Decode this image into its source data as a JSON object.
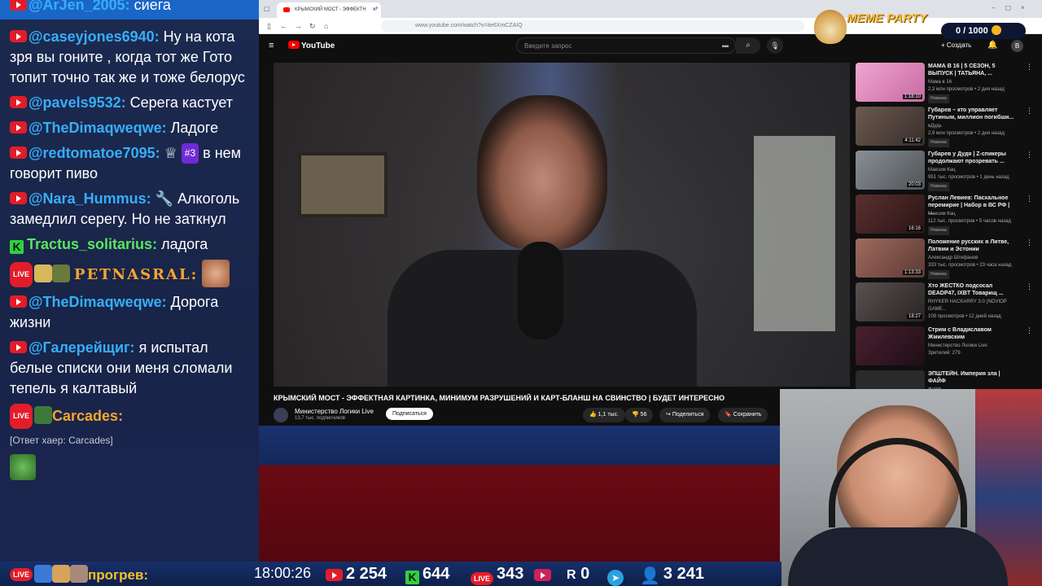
{
  "chat": {
    "messages": [
      {
        "platform": "youtube",
        "user": "@ArJen_2005:",
        "text": "сиега"
      },
      {
        "platform": "youtube",
        "user": "@caseyjones6940:",
        "text": "Ну на кота зря вы гоните , когда тот же Гото топит точно так же и тоже белорус"
      },
      {
        "platform": "youtube",
        "user": "@pavels9532:",
        "text": "Серега кастует"
      },
      {
        "platform": "youtube",
        "user": "@TheDimaqweqwe:",
        "text": "Ладоге"
      },
      {
        "platform": "youtube",
        "user": "@redtomatoe7095:",
        "badge": "#3",
        "text": "в нем говорит пиво"
      },
      {
        "platform": "youtube",
        "user": "@Nara_Hummus:",
        "text": "Алкоголь замедлил серегу. Но не заткнул"
      },
      {
        "platform": "kick",
        "user": "Tractus_solitarius:",
        "text": "ладога"
      },
      {
        "platform": "live",
        "user": "PETNASRAL:",
        "text": ""
      },
      {
        "platform": "youtube",
        "user": "@TheDimaqweqwe:",
        "text": "Дорога жизни"
      },
      {
        "platform": "youtube",
        "user": "@Галерейщиг:",
        "text": "я испытал белые списки они меня сломали тепель я калтавый"
      },
      {
        "platform": "live",
        "user": "Carcades:",
        "text": ""
      }
    ],
    "reply_text": "[Ответ хаер: Carcades]",
    "pending_user": "прогрев:"
  },
  "browser": {
    "tab_title": "КРЫМСКИЙ МОСТ - ЭФФЕКТН",
    "url": "www.youtube.com/watch?v=ite6XmCZAIQ",
    "youtube": {
      "logo": "YouTube",
      "search_placeholder": "Введите запрос",
      "create_label": "Создать",
      "avatar_letter": "В"
    },
    "video": {
      "title": "КРЫМСКИЙ МОСТ - ЭФФЕКТНАЯ КАРТИНКА, МИНИМУМ РАЗРУШЕНИЙ И КАРТ-БЛАНШ НА СВИНСТВО | БУДЕТ ИНТЕРЕСНО",
      "channel": "Министерство Логики Live",
      "subscribers": "13,7 тыс. подписчиков",
      "subscribe_label": "Подписаться",
      "likes": "1,1 тыс.",
      "comments": "56",
      "share_label": "Поделиться",
      "save_label": "Сохранить"
    },
    "recommendations": [
      {
        "title": "МАМА В 16 | 5 СЕЗОН, 5 ВЫПУСК | ТАТЬЯНА, ...",
        "channel": "Мама в 16",
        "meta": "2,3 млн просмотров • 2 дня назад",
        "badge": "Новинка",
        "duration": "1:18:10",
        "thumb_color": "#e889c0"
      },
      {
        "title": "Губарев – кто управляет Путиным, миллион погибши...",
        "channel": "вДудь",
        "meta": "2,9 млн просмотров • 2 дня назад",
        "badge": "Новинка",
        "duration": "4:11:42",
        "thumb_color": "#5a4a44"
      },
      {
        "title": "Губарев у Дудя | Z-спикеры продолжают прозревать ...",
        "channel": "Максим Кац",
        "meta": "951 тыс. просмотров • 1 день назад",
        "badge": "Новинка",
        "duration": "20:03",
        "thumb_color": "#6e7378"
      },
      {
        "title": "Руслан Левиев: Пасхальное перемирие | Набор в ВС РФ | ...",
        "channel": "Максим Кац",
        "meta": "112 тыс. просмотров • 5 часов назад",
        "badge": "Новинка",
        "duration": "16:16",
        "thumb_color": "#4b2a2a"
      },
      {
        "title": "Положение русских в Литве, Латвии и Эстонии",
        "channel": "Александр Штефанов",
        "meta": "333 тыс. просмотров • 23 часа назад",
        "badge": "Новинка",
        "duration": "1:13:33",
        "thumb_color": "#8a5a4e"
      },
      {
        "title": "Хто ЖЕСТКО подсосал DEADP47, IXBT Товарищ ...",
        "channel": "RHYKER HACKARRY 3.0 (NOVIOP GAME...",
        "meta": "109 просмотров • 12 дней назад",
        "badge": "",
        "duration": "18:27",
        "thumb_color": "#4a4040"
      },
      {
        "title": "Стрим с Владиславом Жмилевским",
        "channel": "Министерство Логики Live",
        "meta": "Зрителей: 279",
        "badge": "",
        "duration": "",
        "thumb_color": "#3a1e2a"
      },
      {
        "title": "ЭПШТЕЙН. Империя зла | ФАЙФ",
        "channel": "Файф",
        "meta": "",
        "badge": "",
        "duration": "",
        "thumb_color": "#2a2a2a"
      }
    ]
  },
  "overlay": {
    "brand": "MEME PARTY",
    "progress_text": "0 / 1000"
  },
  "statusbar": {
    "time": "18:00:26",
    "youtube_viewers": "2 254",
    "kick_viewers": "644",
    "live_viewers": "343",
    "rutube_viewers": "0",
    "total_viewers": "3 241"
  }
}
